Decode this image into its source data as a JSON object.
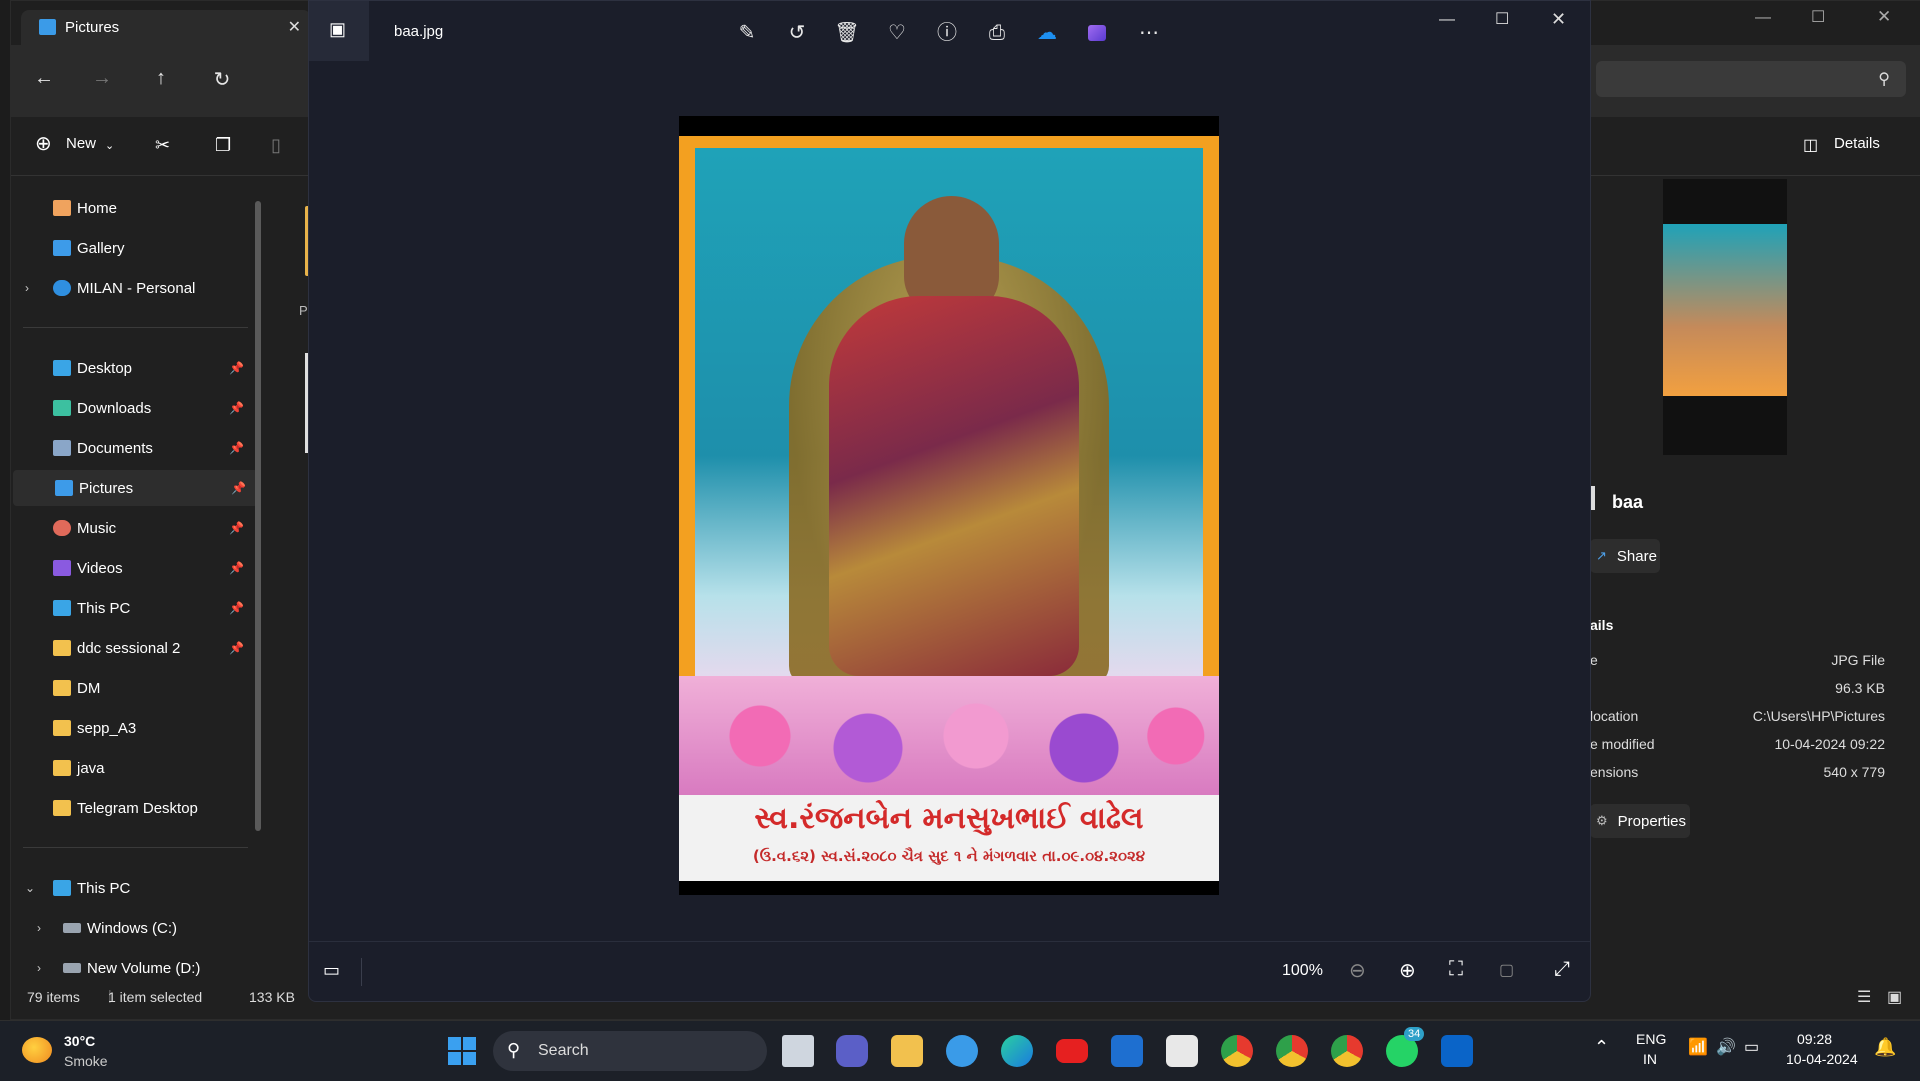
{
  "explorer": {
    "tab_title": "Pictures",
    "new_label": "New",
    "details_label": "Details",
    "partial_label": "Pi",
    "sidebar": [
      {
        "label": "Home",
        "icon": "home-icon",
        "color": "#f0a35e"
      },
      {
        "label": "Gallery",
        "icon": "gallery-icon",
        "color": "#3d9be9"
      },
      {
        "label": "MILAN - Personal",
        "icon": "onedrive-icon",
        "color": "#2f8fe0"
      },
      {
        "label": "Desktop",
        "icon": "desktop-icon",
        "color": "#3aa5e6"
      },
      {
        "label": "Downloads",
        "icon": "download-icon",
        "color": "#3cc0a0"
      },
      {
        "label": "Documents",
        "icon": "documents-icon",
        "color": "#8aa6c8"
      },
      {
        "label": "Pictures",
        "icon": "pictures-icon",
        "color": "#3d9be9"
      },
      {
        "label": "Music",
        "icon": "music-icon",
        "color": "#e06a5a"
      },
      {
        "label": "Videos",
        "icon": "videos-icon",
        "color": "#8a5ae0"
      },
      {
        "label": "This PC",
        "icon": "pc-icon",
        "color": "#3aa5e6"
      },
      {
        "label": "ddc sessional 2",
        "icon": "folder-icon",
        "color": "#f2c14e"
      },
      {
        "label": "DM",
        "icon": "folder-icon",
        "color": "#f2c14e"
      },
      {
        "label": "sepp_A3",
        "icon": "folder-icon",
        "color": "#f2c14e"
      },
      {
        "label": "java",
        "icon": "folder-icon",
        "color": "#f2c14e"
      },
      {
        "label": "Telegram Desktop",
        "icon": "folder-icon",
        "color": "#f2c14e"
      },
      {
        "label": "This PC",
        "icon": "pc-icon",
        "color": "#3aa5e6"
      },
      {
        "label": "Windows (C:)",
        "icon": "drive-icon",
        "color": "#9aa4b0"
      },
      {
        "label": "New Volume (D:)",
        "icon": "drive-icon",
        "color": "#9aa4b0"
      }
    ],
    "status": {
      "items": "79 items",
      "selected": "1 item selected",
      "size": "133 KB"
    },
    "details": {
      "file_name": "baa",
      "share": "Share",
      "section": "ails",
      "properties": "Properties",
      "rows": [
        {
          "key": "e",
          "value": "JPG File"
        },
        {
          "key": "",
          "value": "96.3 KB"
        },
        {
          "key": "location",
          "value": "C:\\Users\\HP\\Pictures"
        },
        {
          "key": "e modified",
          "value": "10-04-2024 09:22"
        },
        {
          "key": "ensions",
          "value": "540 x 779"
        }
      ]
    }
  },
  "photos": {
    "file_name": "baa.jpg",
    "zoom": "100%",
    "caption_line1": "સ્વ.રંજનબેન મનસુખભાઈ વાઢેલ",
    "caption_line2": "(ઉ.વ.૬૨) સ્વ.સં.૨૦૮૦ ચૈત્ર સુદ ૧ ને મંગળવાર તા.૦૯.૦૪.૨૦૨૪"
  },
  "taskbar": {
    "weather_temp": "30°C",
    "weather_desc": "Smoke",
    "search": "Search",
    "lang1": "ENG",
    "lang2": "IN",
    "time": "09:28",
    "date": "10-04-2024",
    "whatsapp_badge": "34"
  }
}
